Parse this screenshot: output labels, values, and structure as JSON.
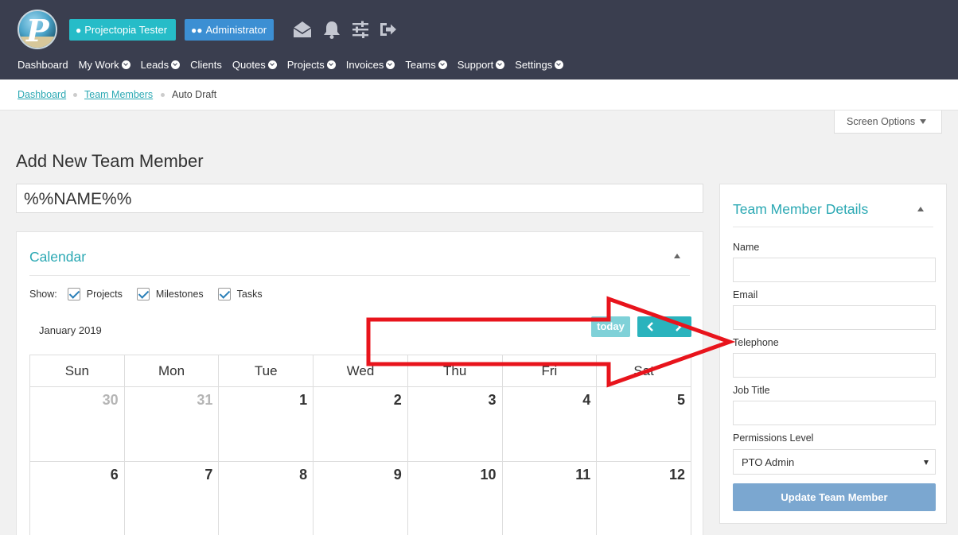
{
  "header": {
    "user_badge": "Projectopia Tester",
    "role_badge": "Administrator",
    "icons": [
      "envelope-icon",
      "bell-icon",
      "sliders-icon",
      "logout-icon"
    ]
  },
  "nav": [
    {
      "label": "Dashboard",
      "has_menu": false
    },
    {
      "label": "My Work",
      "has_menu": true
    },
    {
      "label": "Leads",
      "has_menu": true
    },
    {
      "label": "Clients",
      "has_menu": false
    },
    {
      "label": "Quotes",
      "has_menu": true
    },
    {
      "label": "Projects",
      "has_menu": true
    },
    {
      "label": "Invoices",
      "has_menu": true
    },
    {
      "label": "Teams",
      "has_menu": true
    },
    {
      "label": "Support",
      "has_menu": true
    },
    {
      "label": "Settings",
      "has_menu": true
    }
  ],
  "breadcrumb": {
    "items": [
      "Dashboard",
      "Team Members"
    ],
    "current": "Auto Draft"
  },
  "screen_options": "Screen Options",
  "page_title": "Add New Team Member",
  "title_value": "%%NAME%%",
  "calendar": {
    "title": "Calendar",
    "show_label": "Show:",
    "filters": [
      "Projects",
      "Milestones",
      "Tasks"
    ],
    "month": "January 2019",
    "today_label": "today",
    "weekdays": [
      "Sun",
      "Mon",
      "Tue",
      "Wed",
      "Thu",
      "Fri",
      "Sat"
    ],
    "weeks": [
      [
        {
          "d": "30",
          "other": true
        },
        {
          "d": "31",
          "other": true
        },
        {
          "d": "1"
        },
        {
          "d": "2"
        },
        {
          "d": "3"
        },
        {
          "d": "4"
        },
        {
          "d": "5"
        }
      ],
      [
        {
          "d": "6"
        },
        {
          "d": "7"
        },
        {
          "d": "8"
        },
        {
          "d": "9"
        },
        {
          "d": "10"
        },
        {
          "d": "11"
        },
        {
          "d": "12"
        }
      ]
    ]
  },
  "details": {
    "title": "Team Member Details",
    "fields": {
      "name": "Name",
      "email": "Email",
      "telephone": "Telephone",
      "job_title": "Job Title",
      "permissions": "Permissions Level"
    },
    "permissions_value": "PTO Admin",
    "update_label": "Update Team Member"
  },
  "colors": {
    "topbar": "#3a3e4f",
    "accent": "#2aa8b3",
    "arrow": "#e8141c"
  }
}
